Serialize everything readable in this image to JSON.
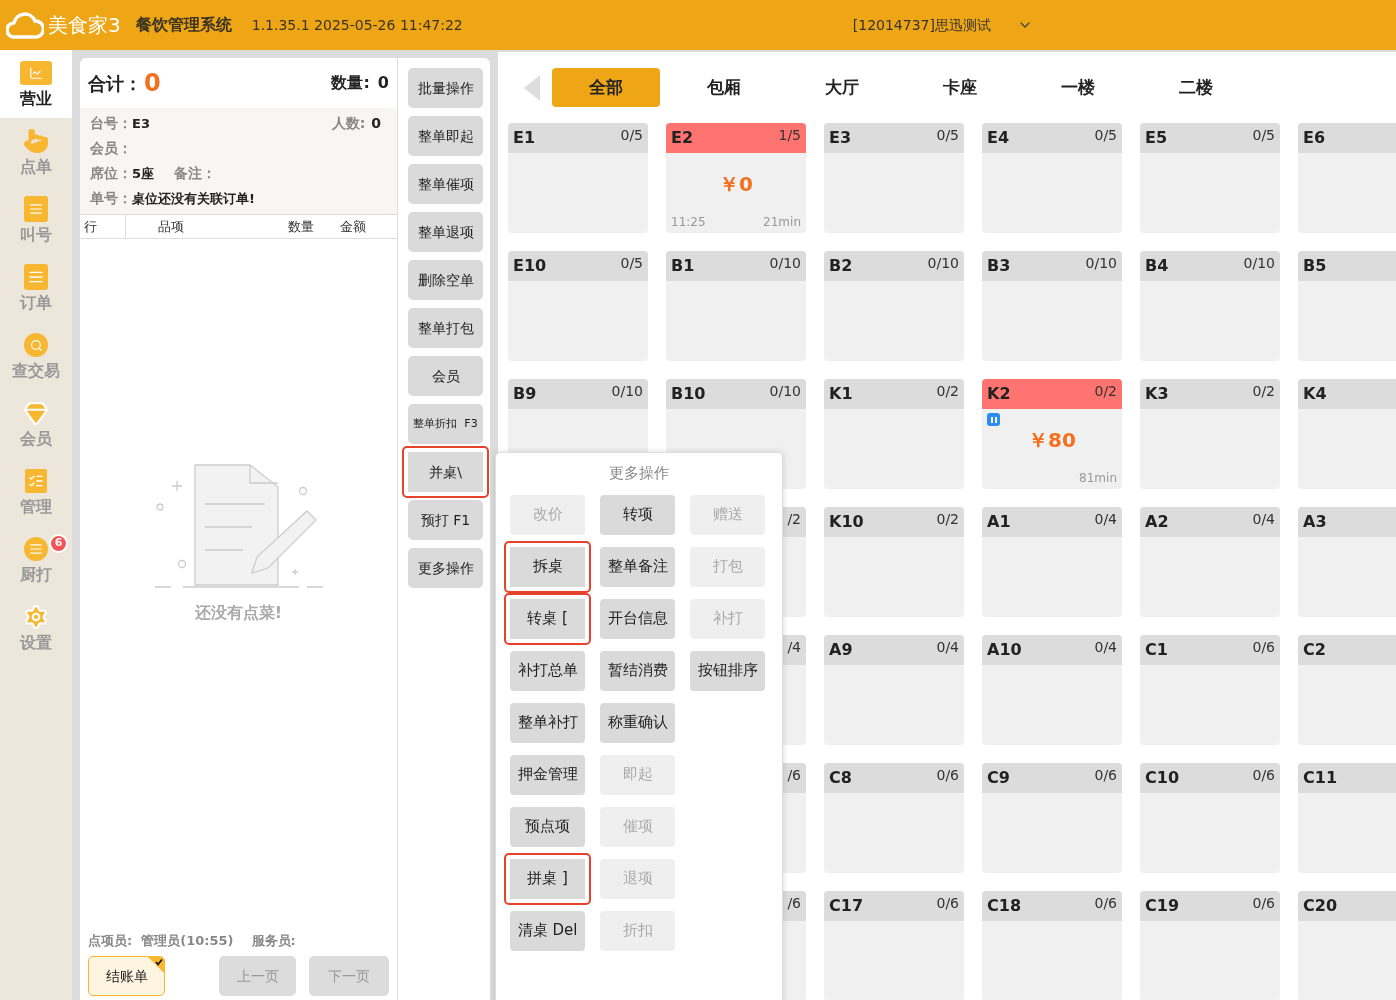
{
  "header": {
    "brand": "美食家3",
    "system": "餐饮管理系统",
    "version": "1.1.35.1 2025-05-26 11:47:22",
    "account": "[12014737]思迅测试"
  },
  "sidebar": {
    "items": [
      {
        "label": "营业",
        "selected": true
      },
      {
        "label": "点单",
        "selected": false
      },
      {
        "label": "叫号",
        "selected": false
      },
      {
        "label": "订单",
        "selected": false
      },
      {
        "label": "查交易",
        "selected": false
      },
      {
        "label": "会员",
        "selected": false
      },
      {
        "label": "管理",
        "selected": false
      },
      {
        "label": "厨打",
        "selected": false,
        "badge": "6"
      },
      {
        "label": "设置",
        "selected": false
      }
    ]
  },
  "order": {
    "total_label": "合计：",
    "total": "0",
    "qty_label": "数量:",
    "qty": "0",
    "info": [
      {
        "label": "台号：",
        "value": "E3",
        "extra_label": "人数:",
        "extra_value": "0"
      },
      {
        "label": "会员："
      },
      {
        "label": "席位：",
        "value": "5座",
        "extra_label": "备注："
      },
      {
        "label": "单号：",
        "value": "桌位还没有关联订单!"
      }
    ],
    "columns": [
      "行",
      "品项",
      "数量",
      "金额"
    ],
    "empty_text": "还没有点菜!",
    "staff": "点项员:  管理员(10:55)    服务员:",
    "buttons": [
      {
        "label": "结账单",
        "checked": true,
        "disabled": false
      },
      {
        "label": "上一页",
        "checked": false,
        "disabled": true
      },
      {
        "label": "下一页",
        "checked": false,
        "disabled": true
      }
    ]
  },
  "actions": [
    {
      "label": "批量操作",
      "highlighted": false
    },
    {
      "label": "整单即起",
      "highlighted": false
    },
    {
      "label": "整单催项",
      "highlighted": false
    },
    {
      "label": "整单退项",
      "highlighted": false
    },
    {
      "label": "删除空单",
      "highlighted": false
    },
    {
      "label": "整单打包",
      "highlighted": false
    },
    {
      "label": "会员",
      "highlighted": false
    },
    {
      "label": "整单折扣  F3",
      "highlighted": false,
      "small": true
    },
    {
      "label": "并桌\\",
      "highlighted": true
    },
    {
      "label": "预打 F1",
      "highlighted": false
    },
    {
      "label": "更多操作",
      "highlighted": false
    }
  ],
  "tabs": [
    {
      "label": "全部",
      "selected": true
    },
    {
      "label": "包厢",
      "selected": false
    },
    {
      "label": "大厅",
      "selected": false
    },
    {
      "label": "卡座",
      "selected": false
    },
    {
      "label": "一楼",
      "selected": false
    },
    {
      "label": "二楼",
      "selected": false
    }
  ],
  "table_rows": [
    [
      {
        "name": "E1",
        "count": "0/5",
        "occupied": false
      },
      {
        "name": "E2",
        "count": "1/5",
        "occupied": true,
        "amount": "￥0",
        "time": "11:25",
        "duration": "21min"
      },
      {
        "name": "E3",
        "count": "0/5",
        "occupied": false
      },
      {
        "name": "E4",
        "count": "0/5",
        "occupied": false
      },
      {
        "name": "E5",
        "count": "0/5",
        "occupied": false
      },
      {
        "name": "E6",
        "occupied": false
      }
    ],
    [
      {
        "name": "E10",
        "count": "0/5",
        "occupied": false
      },
      {
        "name": "B1",
        "count": "0/10",
        "occupied": false
      },
      {
        "name": "B2",
        "count": "0/10",
        "occupied": false
      },
      {
        "name": "B3",
        "count": "0/10",
        "occupied": false
      },
      {
        "name": "B4",
        "count": "0/10",
        "occupied": false
      },
      {
        "name": "B5",
        "occupied": false
      }
    ],
    [
      {
        "name": "B9",
        "count": "0/10",
        "occupied": false
      },
      {
        "name": "B10",
        "count": "0/10",
        "occupied": false
      },
      {
        "name": "K1",
        "count": "0/2",
        "occupied": false
      },
      {
        "name": "K2",
        "count": "0/2",
        "occupied": true,
        "amount": "￥80",
        "duration": "81min",
        "flag": true
      },
      {
        "name": "K3",
        "count": "0/2",
        "occupied": false
      },
      {
        "name": "K4",
        "occupied": false
      }
    ],
    [
      {
        "count": "/2",
        "occupied": false
      },
      {
        "name": "K10",
        "count": "0/2",
        "occupied": false
      },
      {
        "name": "A1",
        "count": "0/4",
        "occupied": false
      },
      {
        "name": "A2",
        "count": "0/4",
        "occupied": false
      },
      {
        "name": "A3",
        "occupied": false
      }
    ],
    [
      {
        "count": "/4",
        "occupied": false
      },
      {
        "name": "A9",
        "count": "0/4",
        "occupied": false
      },
      {
        "name": "A10",
        "count": "0/4",
        "occupied": false
      },
      {
        "name": "C1",
        "count": "0/6",
        "occupied": false
      },
      {
        "name": "C2",
        "occupied": false
      }
    ],
    [
      {
        "count": "/6",
        "occupied": false
      },
      {
        "name": "C8",
        "count": "0/6",
        "occupied": false
      },
      {
        "name": "C9",
        "count": "0/6",
        "occupied": false
      },
      {
        "name": "C10",
        "count": "0/6",
        "occupied": false
      },
      {
        "name": "C11",
        "occupied": false
      }
    ],
    [
      {
        "count": "/6",
        "occupied": false
      },
      {
        "name": "C17",
        "count": "0/6",
        "occupied": false
      },
      {
        "name": "C18",
        "count": "0/6",
        "occupied": false
      },
      {
        "name": "C19",
        "count": "0/6",
        "occupied": false
      },
      {
        "name": "C20",
        "occupied": false
      }
    ]
  ],
  "more_menu": {
    "title": "更多操作",
    "columns": [
      [
        {
          "label": "改价",
          "disabled": true,
          "highlighted": false
        },
        {
          "label": "拆桌",
          "disabled": false,
          "highlighted": true
        },
        {
          "label": "转桌 [",
          "disabled": false,
          "highlighted": true
        },
        {
          "label": "补打总单",
          "disabled": false,
          "highlighted": false
        },
        {
          "label": "整单补打",
          "disabled": false,
          "highlighted": false
        },
        {
          "label": "押金管理",
          "disabled": false,
          "highlighted": false
        },
        {
          "label": "预点项",
          "disabled": false,
          "highlighted": false
        },
        {
          "label": "拼桌 ]",
          "disabled": false,
          "highlighted": true
        },
        {
          "label": "清桌 Del",
          "disabled": false,
          "highlighted": false
        }
      ],
      [
        {
          "label": "转项",
          "disabled": false,
          "highlighted": false
        },
        {
          "label": "整单备注",
          "disabled": false,
          "highlighted": false
        },
        {
          "label": "开台信息",
          "disabled": false,
          "highlighted": false
        },
        {
          "label": "暂结消费",
          "disabled": false,
          "highlighted": false
        },
        {
          "label": "称重确认",
          "disabled": false,
          "highlighted": false
        },
        {
          "label": "即起",
          "disabled": true,
          "highlighted": false
        },
        {
          "label": "催项",
          "disabled": true,
          "highlighted": false
        },
        {
          "label": "退项",
          "disabled": true,
          "highlighted": false
        },
        {
          "label": "折扣",
          "disabled": true,
          "highlighted": false
        }
      ],
      [
        {
          "label": "赠送",
          "disabled": true,
          "highlighted": false
        },
        {
          "label": "打包",
          "disabled": true,
          "highlighted": false
        },
        {
          "label": "补打",
          "disabled": true,
          "highlighted": false
        },
        {
          "label": "按钮排序",
          "disabled": false,
          "highlighted": false
        }
      ]
    ]
  }
}
